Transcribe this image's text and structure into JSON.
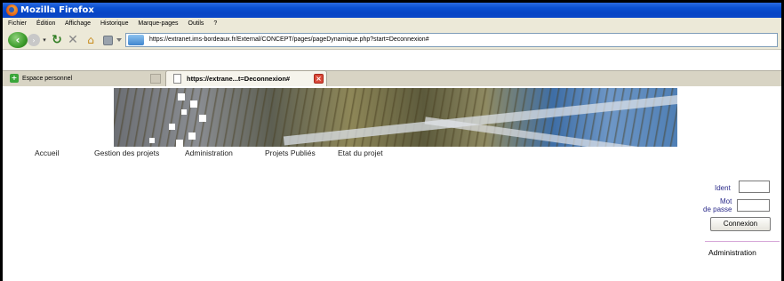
{
  "window": {
    "title": "Mozilla Firefox",
    "logo_icon": "firefox-logo-icon"
  },
  "menu": [
    "Fichier",
    "Édition",
    "Affichage",
    "Historique",
    "Marque-pages",
    "Outils",
    "?"
  ],
  "toolbar": {
    "url": "https://extranet.ims-bordeaux.fr/External/CONCEPT/pages/pageDynamique.php?start=Deconnexion#",
    "icons": [
      "back-icon",
      "forward-icon",
      "history-dropdown-icon",
      "reload-icon",
      "stop-icon",
      "home-icon",
      "extension-icon"
    ]
  },
  "tabbar": {
    "bookmark_label": "Espace personnel",
    "active_tab_label": "https://extrane...t=Deconnexion#"
  },
  "page": {
    "nav": [
      "Accueil",
      "Gestion des projets",
      "Administration",
      "Projets Publiés",
      "Etat du projet"
    ],
    "login": {
      "ident_label": "Ident",
      "mot_label": "Mot",
      "passe_label": "de passe",
      "button_label": "Connexion",
      "ident_value": "",
      "password_value": ""
    },
    "side_link": "Administration"
  },
  "colors": {
    "titlebar": "#0a4fd0",
    "chrome": "#ece9d8",
    "login_label": "#2a2a8a"
  }
}
